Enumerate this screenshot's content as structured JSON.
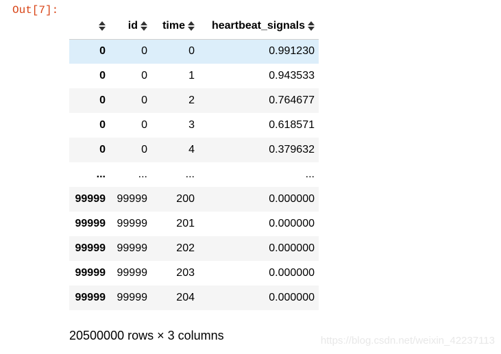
{
  "prompt": "Out[7]:",
  "table": {
    "columns": [
      "",
      "id",
      "time",
      "heartbeat_signals"
    ],
    "rows": [
      {
        "index": "0",
        "id": "0",
        "time": "0",
        "signal": "0.991230"
      },
      {
        "index": "0",
        "id": "0",
        "time": "1",
        "signal": "0.943533"
      },
      {
        "index": "0",
        "id": "0",
        "time": "2",
        "signal": "0.764677"
      },
      {
        "index": "0",
        "id": "0",
        "time": "3",
        "signal": "0.618571"
      },
      {
        "index": "0",
        "id": "0",
        "time": "4",
        "signal": "0.379632"
      },
      {
        "index": "...",
        "id": "...",
        "time": "...",
        "signal": "..."
      },
      {
        "index": "99999",
        "id": "99999",
        "time": "200",
        "signal": "0.000000"
      },
      {
        "index": "99999",
        "id": "99999",
        "time": "201",
        "signal": "0.000000"
      },
      {
        "index": "99999",
        "id": "99999",
        "time": "202",
        "signal": "0.000000"
      },
      {
        "index": "99999",
        "id": "99999",
        "time": "203",
        "signal": "0.000000"
      },
      {
        "index": "99999",
        "id": "99999",
        "time": "204",
        "signal": "0.000000"
      }
    ],
    "selected_row": 0
  },
  "shape_info": "20500000 rows × 3 columns",
  "watermark": "https://blog.csdn.net/weixin_42237113",
  "icons": {
    "sort": "sort-icon"
  },
  "colors": {
    "prompt": "#d84315",
    "selected_row": "#dceefa",
    "striped_row": "#f5f5f5"
  }
}
